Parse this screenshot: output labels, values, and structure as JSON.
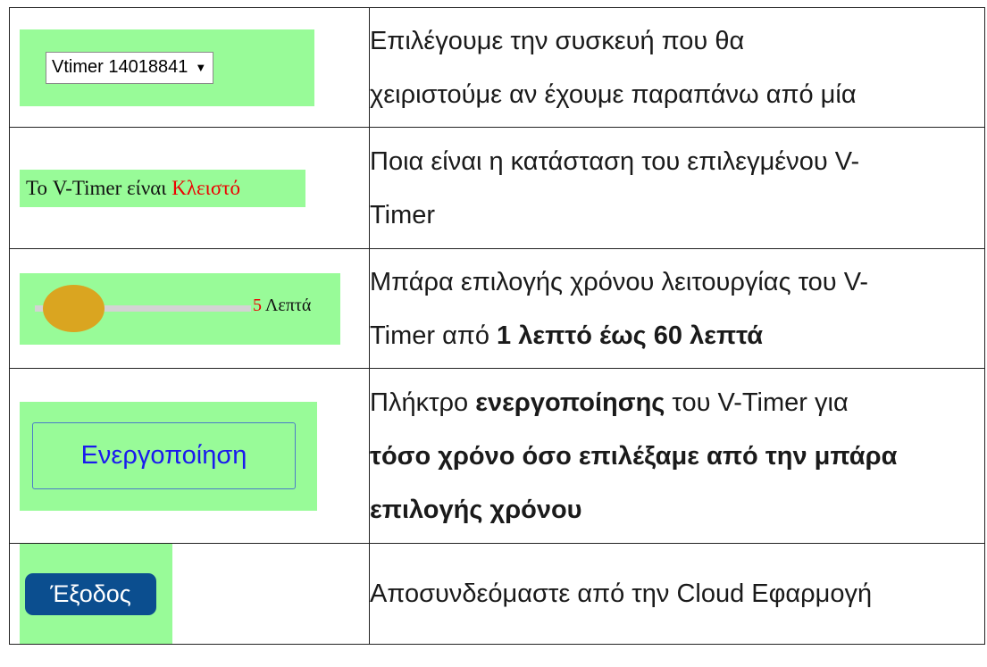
{
  "rows": [
    {
      "widget": {
        "device_select_value": "Vtimer 14018841",
        "caret_icon": "▼"
      },
      "desc_lines": [
        "Επιλέγουμε την συσκευή που θα",
        "χειριστούμε αν έχουμε παραπάνω από μία"
      ]
    },
    {
      "widget": {
        "status_prefix": "Το V-Timer είναι ",
        "status_value": "Κλειστό",
        "status_value_color": "#ee0000"
      },
      "desc_lines": [
        "Ποια είναι η κατάσταση του επιλεγμένου V-",
        "Timer"
      ]
    },
    {
      "widget": {
        "slider_minutes": "5",
        "slider_unit": " Λεπτά",
        "slider_thumb_color": "#daa520"
      },
      "desc_line1": "Μπάρα επιλογής χρόνου λειτουργίας του V-",
      "desc_line2_prefix": "Timer από ",
      "desc_line2_bold": "1 λεπτό έως 60 λεπτά"
    },
    {
      "widget": {
        "activate_button_label": "Ενεργοποίηση"
      },
      "desc_line1_prefix": "Πλήκτρο ",
      "desc_line1_bold": "ενεργοποίησης",
      "desc_line1_suffix": " του V-Timer για",
      "desc_line2_bold": "τόσο χρόνο όσο επιλέξαμε από την μπάρα",
      "desc_line3_bold": "επιλογής χρόνου"
    },
    {
      "widget": {
        "exit_button_label": "Έξοδος",
        "exit_button_color": "#0b4e8f"
      },
      "desc_line1": "Αποσυνδεόμαστε από την Cloud Εφαρμογή"
    }
  ],
  "theme": {
    "widget_background": "#98fb98",
    "border_color": "#222222"
  }
}
